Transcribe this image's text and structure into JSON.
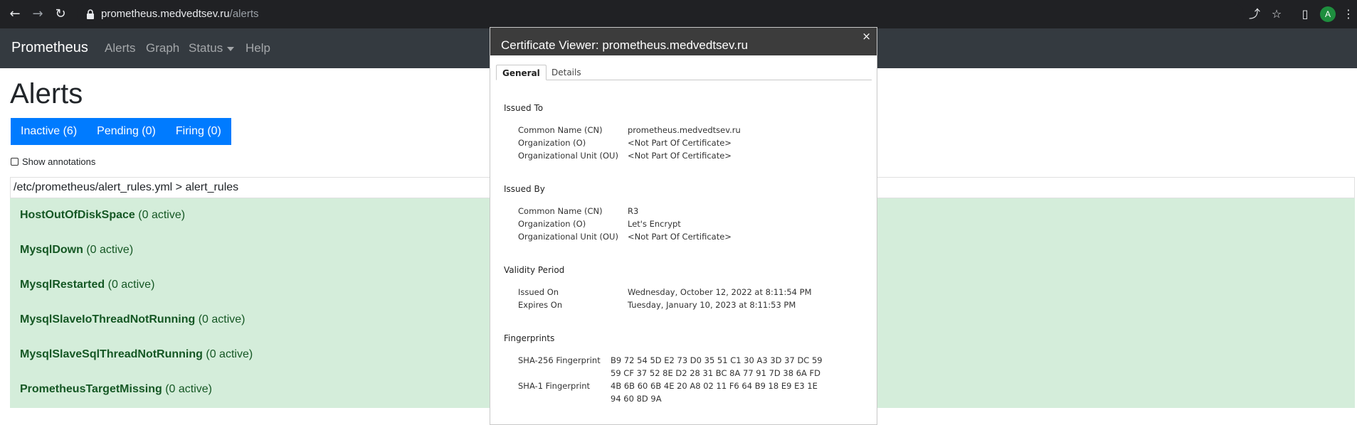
{
  "browser": {
    "back_icon": "arrow-left",
    "forward_icon": "arrow-right",
    "reload_icon": "reload",
    "url_host": "prometheus.medvedtsev.ru",
    "url_path": "/alerts",
    "avatar_letter": "A"
  },
  "nav": {
    "brand": "Prometheus",
    "links": [
      "Alerts",
      "Graph",
      "Status",
      "Help"
    ]
  },
  "page": {
    "title": "Alerts",
    "filters": [
      "Inactive (6)",
      "Pending (0)",
      "Firing (0)"
    ],
    "show_annotations": "Show annotations",
    "rules_file": "/etc/prometheus/alert_rules.yml > alert_rules",
    "rules": [
      {
        "name": "HostOutOfDiskSpace",
        "status": "(0 active)"
      },
      {
        "name": "MysqlDown",
        "status": "(0 active)"
      },
      {
        "name": "MysqlRestarted",
        "status": "(0 active)"
      },
      {
        "name": "MysqlSlaveIoThreadNotRunning",
        "status": "(0 active)"
      },
      {
        "name": "MysqlSlaveSqlThreadNotRunning",
        "status": "(0 active)"
      },
      {
        "name": "PrometheusTargetMissing",
        "status": "(0 active)"
      }
    ]
  },
  "cert": {
    "title": "Certificate Viewer: prometheus.medvedtsev.ru",
    "close": "×",
    "tabs": [
      "General",
      "Details"
    ],
    "issued_to": {
      "heading": "Issued To",
      "cn_label": "Common Name (CN)",
      "cn": "prometheus.medvedtsev.ru",
      "o_label": "Organization (O)",
      "o": "<Not Part Of Certificate>",
      "ou_label": "Organizational Unit (OU)",
      "ou": "<Not Part Of Certificate>"
    },
    "issued_by": {
      "heading": "Issued By",
      "cn_label": "Common Name (CN)",
      "cn": "R3",
      "o_label": "Organization (O)",
      "o": "Let's Encrypt",
      "ou_label": "Organizational Unit (OU)",
      "ou": "<Not Part Of Certificate>"
    },
    "validity": {
      "heading": "Validity Period",
      "issued_label": "Issued On",
      "issued": "Wednesday, October 12, 2022 at 8:11:54 PM",
      "expires_label": "Expires On",
      "expires": "Tuesday, January 10, 2023 at 8:11:53 PM"
    },
    "fingerprints": {
      "heading": "Fingerprints",
      "sha256_label": "SHA-256 Fingerprint",
      "sha256_1": "B9 72 54 5D E2 73 D0 35 51 C1 30 A3 3D 37 DC 59",
      "sha256_2": "59 CF 37 52 8E D2 28 31 BC 8A 77 91 7D 38 6A FD",
      "sha1_label": "SHA-1 Fingerprint",
      "sha1_1": "4B 6B 60 6B 4E 20 A8 02 11 F6 64 B9 18 E9 E3 1E",
      "sha1_2": "94 60 8D 9A"
    }
  }
}
